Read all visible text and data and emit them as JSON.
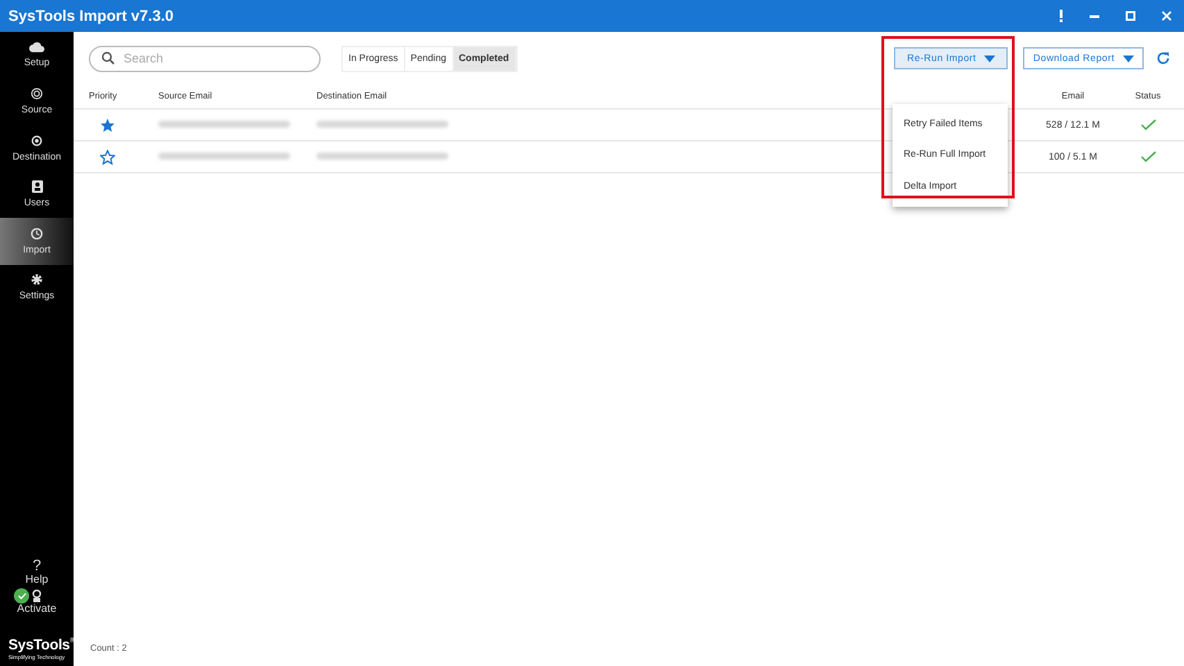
{
  "window": {
    "title": "SysTools Import v7.3.0"
  },
  "sidebar": {
    "items": [
      {
        "label": "Setup",
        "selected": false
      },
      {
        "label": "Source",
        "selected": false
      },
      {
        "label": "Destination",
        "selected": false
      },
      {
        "label": "Users",
        "selected": false
      },
      {
        "label": "Import",
        "selected": true
      },
      {
        "label": "Settings",
        "selected": false
      }
    ],
    "help": {
      "glyph": "?",
      "label": "Help"
    },
    "activate": {
      "label": "Activate",
      "activated": true
    },
    "logo": {
      "name": "SysTools",
      "mark": "®",
      "tagline": "Simplifying Technology"
    }
  },
  "search": {
    "placeholder": "Search"
  },
  "tabs": [
    {
      "label": "In Progress",
      "selected": false
    },
    {
      "label": "Pending",
      "selected": false
    },
    {
      "label": "Completed",
      "selected": true
    }
  ],
  "actions": {
    "rerun": "Re-Run Import",
    "download": "Download Report"
  },
  "menu": {
    "items": [
      "Retry Failed Items",
      "Re-Run Full Import",
      "Delta Import"
    ],
    "highlighted": true
  },
  "table": {
    "columns": [
      "Priority",
      "Source Email",
      "Destination Email",
      "Email",
      "Status"
    ],
    "rows": [
      {
        "starred": true,
        "email_count": "528 / 12.1 M",
        "completed": true
      },
      {
        "starred": false,
        "email_count": "100 / 5.1 M",
        "completed": true
      }
    ]
  },
  "status_bar": {
    "count": "Count : 2"
  }
}
